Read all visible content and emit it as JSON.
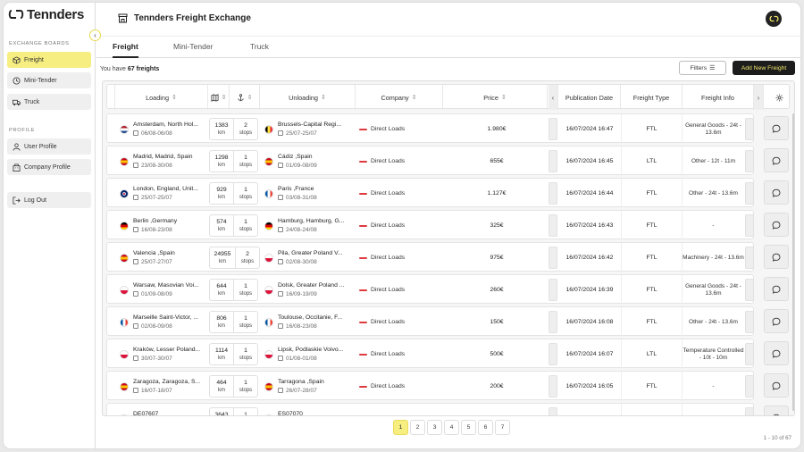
{
  "app": {
    "logo_text": "Tennders",
    "header_title": "Tennders Freight Exchange"
  },
  "sidebar": {
    "section_exchange": "EXCHANGE BOARDS",
    "section_profile": "PROFILE",
    "items": [
      {
        "label": "Freight",
        "icon": "box-icon"
      },
      {
        "label": "Mini-Tender",
        "icon": "clock-icon"
      },
      {
        "label": "Truck",
        "icon": "truck-icon"
      },
      {
        "label": "User Profile",
        "icon": "user-icon"
      },
      {
        "label": "Company Profile",
        "icon": "building-icon"
      },
      {
        "label": "Log Out",
        "icon": "logout-icon"
      }
    ]
  },
  "tabs": [
    "Freight",
    "Mini-Tender",
    "Truck"
  ],
  "summary": {
    "prefix": "You have",
    "count": "67 freights"
  },
  "toolbar": {
    "filters_label": "Filters",
    "add_label": "Add New Freight"
  },
  "columns": {
    "loading": "Loading",
    "unloading": "Unloading",
    "company": "Company",
    "price": "Price",
    "publication": "Publication Date",
    "type": "Freight Type",
    "info": "Freight Info"
  },
  "rows": [
    {
      "from": "Amsterdam, North Hol...",
      "from_flag": "nl",
      "from_date": "06/08-06/08",
      "km": "1383",
      "stops": "2",
      "to": "Brussels-Capital Regi...",
      "to_flag": "be",
      "to_date": "25/07-25/07",
      "company": "Direct Loads",
      "price": "1.980€",
      "pub": "16/07/2024 16:47",
      "type": "FTL",
      "info": "General Goods - 24t - 13.6m"
    },
    {
      "from": "Madrid, Madrid, Spain",
      "from_flag": "es",
      "from_date": "23/08-30/08",
      "km": "1298",
      "stops": "1",
      "to": "Cádiz ,Spain",
      "to_flag": "es",
      "to_date": "01/09-08/09",
      "company": "Direct Loads",
      "price": "655€",
      "pub": "16/07/2024 16:45",
      "type": "LTL",
      "info": "Other - 12t - 11m"
    },
    {
      "from": "London, England, Unit...",
      "from_flag": "uk",
      "from_date": "25/07-25/07",
      "km": "929",
      "stops": "1",
      "to": "Paris ,France",
      "to_flag": "fr",
      "to_date": "03/08-31/08",
      "company": "Direct Loads",
      "price": "1.127€",
      "pub": "16/07/2024 16:44",
      "type": "FTL",
      "info": "Other - 24t - 13.6m"
    },
    {
      "from": "Berlin ,Germany",
      "from_flag": "de",
      "from_date": "16/08-23/08",
      "km": "574",
      "stops": "1",
      "to": "Hamburg, Hamburg, G...",
      "to_flag": "de",
      "to_date": "24/08-24/08",
      "company": "Direct Loads",
      "price": "325€",
      "pub": "16/07/2024 16:43",
      "type": "FTL",
      "info": "-"
    },
    {
      "from": "Valencia ,Spain",
      "from_flag": "es",
      "from_date": "25/07-27/07",
      "km": "24955",
      "stops": "2",
      "to": "Pila, Greater Poland V...",
      "to_flag": "pl",
      "to_date": "02/08-30/08",
      "company": "Direct Loads",
      "price": "975€",
      "pub": "16/07/2024 16:42",
      "type": "FTL",
      "info": "Machinery - 24t - 13.6m"
    },
    {
      "from": "Warsaw, Masovian Voi...",
      "from_flag": "pl",
      "from_date": "01/09-08/09",
      "km": "644",
      "stops": "1",
      "to": "Dolsk, Greater Poland ...",
      "to_flag": "pl",
      "to_date": "16/09-19/09",
      "company": "Direct Loads",
      "price": "260€",
      "pub": "16/07/2024 16:39",
      "type": "FTL",
      "info": "General Goods - 24t - 13.6m"
    },
    {
      "from": "Marseille Saint-Victor, ...",
      "from_flag": "fr",
      "from_date": "02/08-09/08",
      "km": "806",
      "stops": "1",
      "to": "Toulouse, Occitanie, F...",
      "to_flag": "fr",
      "to_date": "16/08-23/08",
      "company": "Direct Loads",
      "price": "150€",
      "pub": "16/07/2024 16:08",
      "type": "FTL",
      "info": "Other - 24t - 13.6m"
    },
    {
      "from": "Kraków, Lesser Poland...",
      "from_flag": "pl",
      "from_date": "30/07-30/07",
      "km": "1114",
      "stops": "1",
      "to": "Lipsk, Podlaskie Voivo...",
      "to_flag": "pl",
      "to_date": "01/08-01/08",
      "company": "Direct Loads",
      "price": "500€",
      "pub": "16/07/2024 16:07",
      "type": "LTL",
      "info": "Temperature Controlled - 10t - 10m"
    },
    {
      "from": "Zaragoza, Zaragoza, S...",
      "from_flag": "es",
      "from_date": "16/07-18/07",
      "km": "464",
      "stops": "1",
      "to": "Tarragona ,Spain",
      "to_flag": "es",
      "to_date": "26/07-28/07",
      "company": "Direct Loads",
      "price": "200€",
      "pub": "16/07/2024 16:05",
      "type": "FTL",
      "info": "-"
    },
    {
      "from": "DE07607",
      "from_flag": "de",
      "from_date": "",
      "km": "3643",
      "stops": "1",
      "to": "ES07070",
      "to_flag": "es",
      "to_date": "",
      "company": "",
      "price": "",
      "pub": "",
      "type": "",
      "info": ""
    }
  ],
  "pagination": {
    "pages": [
      "1",
      "2",
      "3",
      "4",
      "5",
      "6",
      "7"
    ],
    "active": "1",
    "range": "1 - 10 of 67"
  },
  "sub_labels": {
    "km": "km",
    "stops": "stops"
  },
  "colors": {
    "accent": "#f7ee82",
    "dark": "#1c1c1c"
  }
}
